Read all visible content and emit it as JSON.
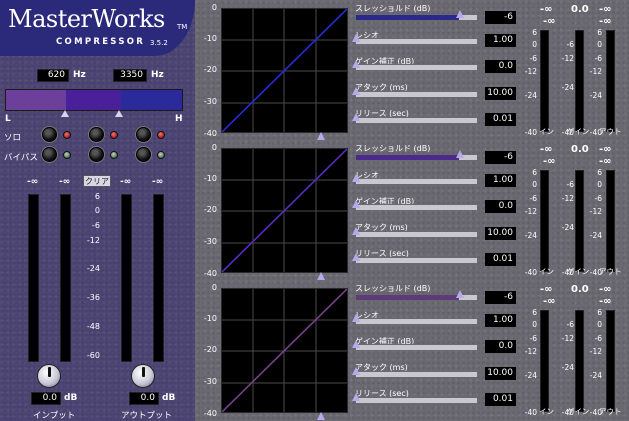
{
  "logo": {
    "title": "MasterWorks",
    "tm": "TM",
    "subtitle": "COMPRESSOR",
    "version": "3.5.2"
  },
  "crossover": {
    "low_value": "620",
    "high_value": "3350",
    "unit": "Hz",
    "left_label": "L",
    "right_label": "H"
  },
  "band_controls": {
    "solo_label": "ソロ",
    "bypass_label": "バイパス"
  },
  "io_meters": {
    "input_peak": "-∞",
    "input_peak2": "-∞",
    "output_peak": "-∞",
    "output_peak2": "-∞",
    "clear_label": "クリア",
    "scale": [
      "6",
      "0",
      "-6",
      "-12",
      "-24",
      "-36",
      "-48",
      "-60"
    ]
  },
  "gain": {
    "input_value": "0.0",
    "output_value": "0.0",
    "unit": "dB",
    "input_label": "インプット",
    "output_label": "アウトプット"
  },
  "graph_ticks": [
    "0",
    "-10",
    "-20",
    "-30",
    "-40"
  ],
  "bands": [
    {
      "threshold_label": "スレッショルド (dB)",
      "threshold_value": "-6",
      "ratio_label": "レシオ",
      "ratio_value": "1.00",
      "gain_label": "ゲイン補正 (dB)",
      "gain_value": "0.0",
      "attack_label": "アタック (ms)",
      "attack_value": "10.00",
      "release_label": "リリース (sec)",
      "release_value": "0.01",
      "peak_in": "-∞",
      "peak_gain": "0.0",
      "peak_out": "-∞",
      "meter_scale": [
        "6",
        "0",
        "-6",
        "-12",
        "-24",
        "-40"
      ],
      "gain_scale": [
        "-6",
        "-12",
        "-24",
        "-40"
      ],
      "in_label": "イン",
      "gain_meter_label": "ゲイン",
      "out_label": "アウト",
      "curve_color": "#2a2bd6",
      "threshold_fill": "#2a2a8c"
    },
    {
      "threshold_label": "スレッショルド (dB)",
      "threshold_value": "-6",
      "ratio_label": "レシオ",
      "ratio_value": "1.00",
      "gain_label": "ゲイン補正 (dB)",
      "gain_value": "0.0",
      "attack_label": "アタック (ms)",
      "attack_value": "10.00",
      "release_label": "リリース (sec)",
      "release_value": "0.01",
      "peak_in": "-∞",
      "peak_gain": "0.0",
      "peak_out": "-∞",
      "meter_scale": [
        "6",
        "0",
        "-6",
        "-12",
        "-24",
        "-40"
      ],
      "gain_scale": [
        "-6",
        "-12",
        "-24",
        "-40"
      ],
      "in_label": "イン",
      "gain_meter_label": "ゲイン",
      "out_label": "アウト",
      "curve_color": "#5b2bc0",
      "threshold_fill": "#4a2a8a"
    },
    {
      "threshold_label": "スレッショルド (dB)",
      "threshold_value": "-6",
      "ratio_label": "レシオ",
      "ratio_value": "1.00",
      "gain_label": "ゲイン補正 (dB)",
      "gain_value": "0.0",
      "attack_label": "アタック (ms)",
      "attack_value": "10.00",
      "release_label": "リリース (sec)",
      "release_value": "0.01",
      "peak_in": "-∞",
      "peak_gain": "0.0",
      "peak_out": "-∞",
      "meter_scale": [
        "6",
        "0",
        "-6",
        "-12",
        "-24",
        "-40"
      ],
      "gain_scale": [
        "-6",
        "-12",
        "-24",
        "-40"
      ],
      "in_label": "イン",
      "gain_meter_label": "ゲイン",
      "out_label": "アウト",
      "curve_color": "#7a3f8a",
      "threshold_fill": "#5d3a78"
    }
  ],
  "colors": {
    "panel": "#4d4675",
    "logo_bg": "#2b2a7a",
    "band_low": "#6b3f9a",
    "band_mid": "#4a1f9a",
    "band_high": "#2a2a9a"
  }
}
